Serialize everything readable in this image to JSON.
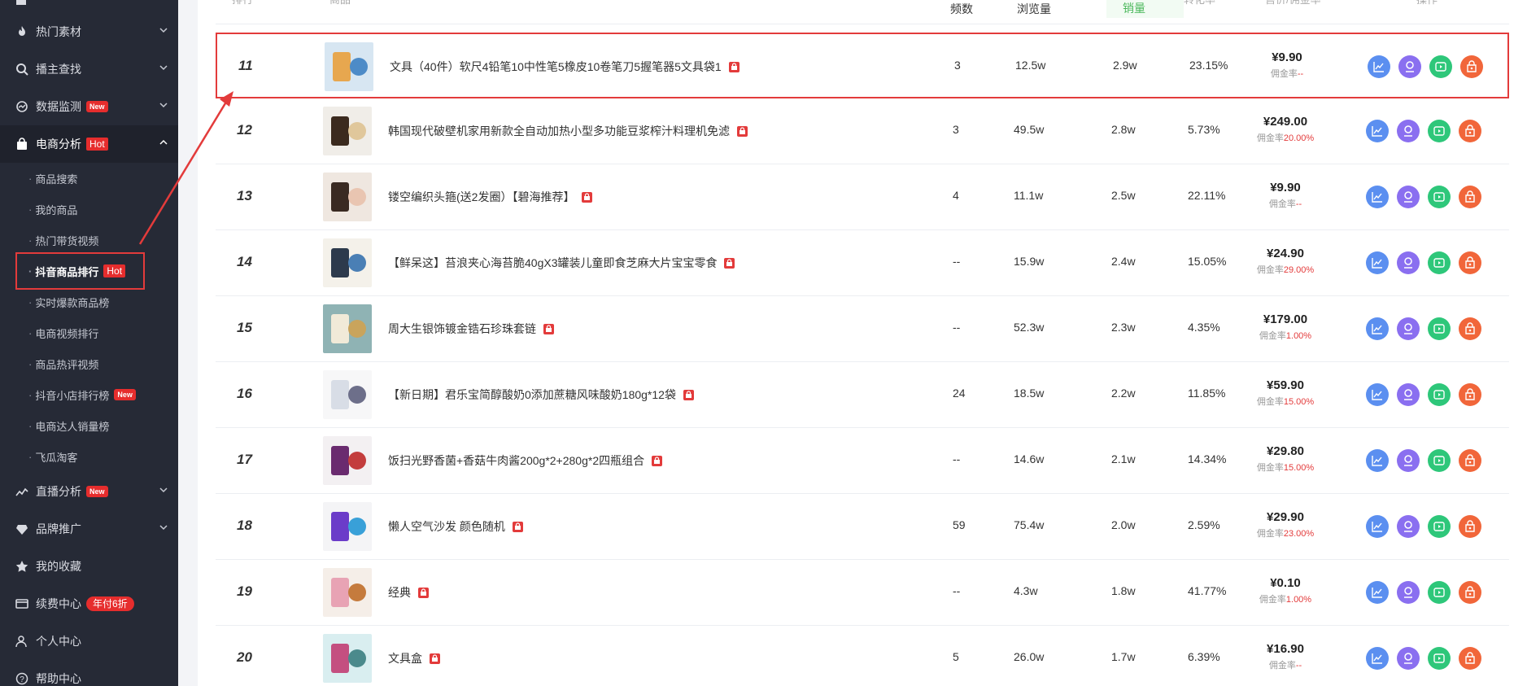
{
  "sidebar": {
    "items": [
      {
        "label": "热门素材",
        "icon": "fire-icon"
      },
      {
        "label": "播主查找",
        "icon": "search-icon"
      },
      {
        "label": "数据监测",
        "icon": "monitor-icon",
        "badge": "New"
      },
      {
        "label": "电商分析",
        "icon": "bag-icon",
        "badge": "Hot"
      },
      {
        "label": "直播分析",
        "icon": "trend-icon",
        "badge": "New"
      },
      {
        "label": "品牌推广",
        "icon": "diamond-icon"
      },
      {
        "label": "我的收藏",
        "icon": "star-icon"
      },
      {
        "label": "续费中心",
        "icon": "card-icon",
        "badge": "年付6折"
      },
      {
        "label": "个人中心",
        "icon": "person-icon"
      },
      {
        "label": "帮助中心",
        "icon": "help-icon"
      }
    ],
    "sub_items": [
      {
        "label": "商品搜索"
      },
      {
        "label": "我的商品"
      },
      {
        "label": "热门带货视频"
      },
      {
        "label": "抖音商品排行",
        "badge": "Hot"
      },
      {
        "label": "实时爆款商品榜"
      },
      {
        "label": "电商视频排行"
      },
      {
        "label": "商品热评视频"
      },
      {
        "label": "抖音小店排行榜",
        "badge": "New"
      },
      {
        "label": "电商达人销量榜"
      },
      {
        "label": "飞瓜淘客"
      }
    ],
    "bullet": "·"
  },
  "table": {
    "headers": {
      "rank": "排行",
      "product": "商品",
      "frequency": "频数",
      "views": "浏览量",
      "sales": "销量",
      "conversion": "转化率",
      "price": "售价/佣金率",
      "actions": "操作"
    },
    "commission_label": "佣金率",
    "rows": [
      {
        "rank": "11",
        "title": "文具（40件）软尺4铅笔10中性笔5橡皮10卷笔刀5握笔器5文具袋1",
        "frequency": "3",
        "views": "12.5w",
        "sales": "2.9w",
        "conversion": "23.15%",
        "price": "¥9.90",
        "commission": "--"
      },
      {
        "rank": "12",
        "title": "韩国现代破壁机家用新款全自动加热小型多功能豆浆榨汁料理机免滤",
        "frequency": "3",
        "views": "49.5w",
        "sales": "2.8w",
        "conversion": "5.73%",
        "price": "¥249.00",
        "commission": "20.00%"
      },
      {
        "rank": "13",
        "title": "镂空编织头箍(送2发圈）【碧海推荐】",
        "frequency": "4",
        "views": "11.1w",
        "sales": "2.5w",
        "conversion": "22.11%",
        "price": "¥9.90",
        "commission": "--"
      },
      {
        "rank": "14",
        "title": "【鲜呆这】苔浪夹心海苔脆40gX3罐装儿童即食芝麻大片宝宝零食",
        "frequency": "--",
        "views": "15.9w",
        "sales": "2.4w",
        "conversion": "15.05%",
        "price": "¥24.90",
        "commission": "29.00%"
      },
      {
        "rank": "15",
        "title": "周大生银饰镀金锆石珍珠套链",
        "frequency": "--",
        "views": "52.3w",
        "sales": "2.3w",
        "conversion": "4.35%",
        "price": "¥179.00",
        "commission": "1.00%"
      },
      {
        "rank": "16",
        "title": "【新日期】君乐宝简醇酸奶0添加蔗糖风味酸奶180g*12袋",
        "frequency": "24",
        "views": "18.5w",
        "sales": "2.2w",
        "conversion": "11.85%",
        "price": "¥59.90",
        "commission": "15.00%"
      },
      {
        "rank": "17",
        "title": "饭扫光野香菌+香菇牛肉酱200g*2+280g*2四瓶组合",
        "frequency": "--",
        "views": "14.6w",
        "sales": "2.1w",
        "conversion": "14.34%",
        "price": "¥29.80",
        "commission": "15.00%"
      },
      {
        "rank": "18",
        "title": "懒人空气沙发 颜色随机",
        "frequency": "59",
        "views": "75.4w",
        "sales": "2.0w",
        "conversion": "2.59%",
        "price": "¥29.90",
        "commission": "23.00%"
      },
      {
        "rank": "19",
        "title": "经典",
        "frequency": "--",
        "views": "4.3w",
        "sales": "1.8w",
        "conversion": "41.77%",
        "price": "¥0.10",
        "commission": "1.00%"
      },
      {
        "rank": "20",
        "title": "文具盒",
        "frequency": "5",
        "views": "26.0w",
        "sales": "1.7w",
        "conversion": "6.39%",
        "price": "¥16.90",
        "commission": "--"
      }
    ]
  },
  "colors": {
    "sidebar_bg": "#262a36",
    "highlight": "#e33b3b",
    "sales_header": "#4cb85c",
    "trend": "#5b8ff0",
    "user": "#8a6ff0",
    "video": "#2ec77a",
    "shop": "#f1663a"
  }
}
